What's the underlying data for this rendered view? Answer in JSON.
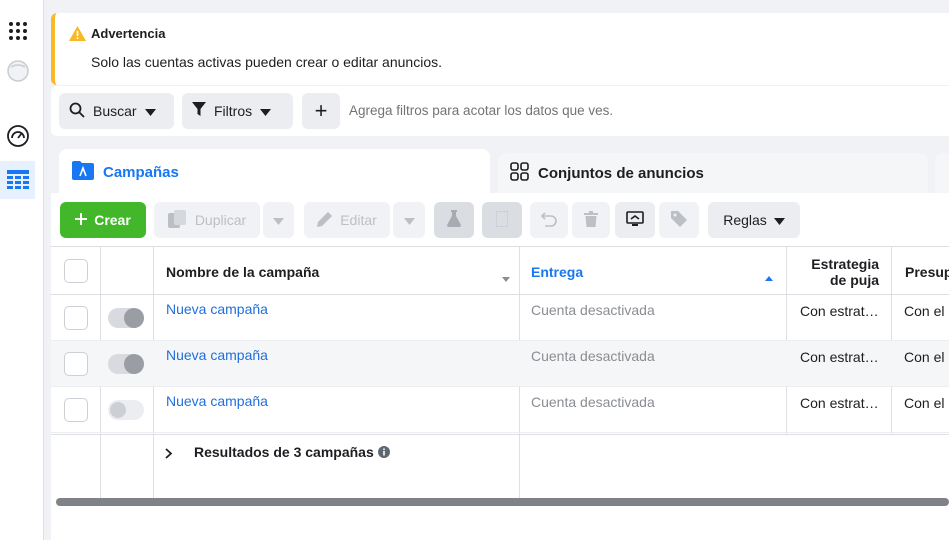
{
  "warning": {
    "title": "Advertencia",
    "message": "Solo las cuentas activas pueden crear o editar anuncios."
  },
  "filters": {
    "search_label": "Buscar",
    "filters_label": "Filtros",
    "add_symbol": "+",
    "placeholder": "Agrega filtros para acotar los datos que ves."
  },
  "tabs": [
    {
      "label": "Campañas"
    },
    {
      "label": "Conjuntos de anuncios"
    }
  ],
  "toolbar": {
    "create_label": "Crear",
    "duplicate_label": "Duplicar",
    "edit_label": "Editar",
    "rules_label": "Reglas"
  },
  "table": {
    "headers": {
      "name": "Nombre de la campaña",
      "delivery": "Entrega",
      "bid_line1": "Estrategia",
      "bid_line2": "de puja",
      "budget": "Presup"
    },
    "rows": [
      {
        "name": "Nueva campaña",
        "delivery": "Cuenta desactivada",
        "bid": "Con estrat…",
        "budget": "Con el",
        "toggle": "on"
      },
      {
        "name": "Nueva campaña",
        "delivery": "Cuenta desactivada",
        "bid": "Con estrat…",
        "budget": "Con el",
        "toggle": "on"
      },
      {
        "name": "Nueva campaña",
        "delivery": "Cuenta desactivada",
        "bid": "Con estrat…",
        "budget": "Con el",
        "toggle": "off"
      }
    ],
    "summary": "Resultados de 3 campañas"
  },
  "colors": {
    "accent": "#1877f2",
    "create": "#42b72a",
    "warning": "#f7b928",
    "link": "#216fdb"
  }
}
